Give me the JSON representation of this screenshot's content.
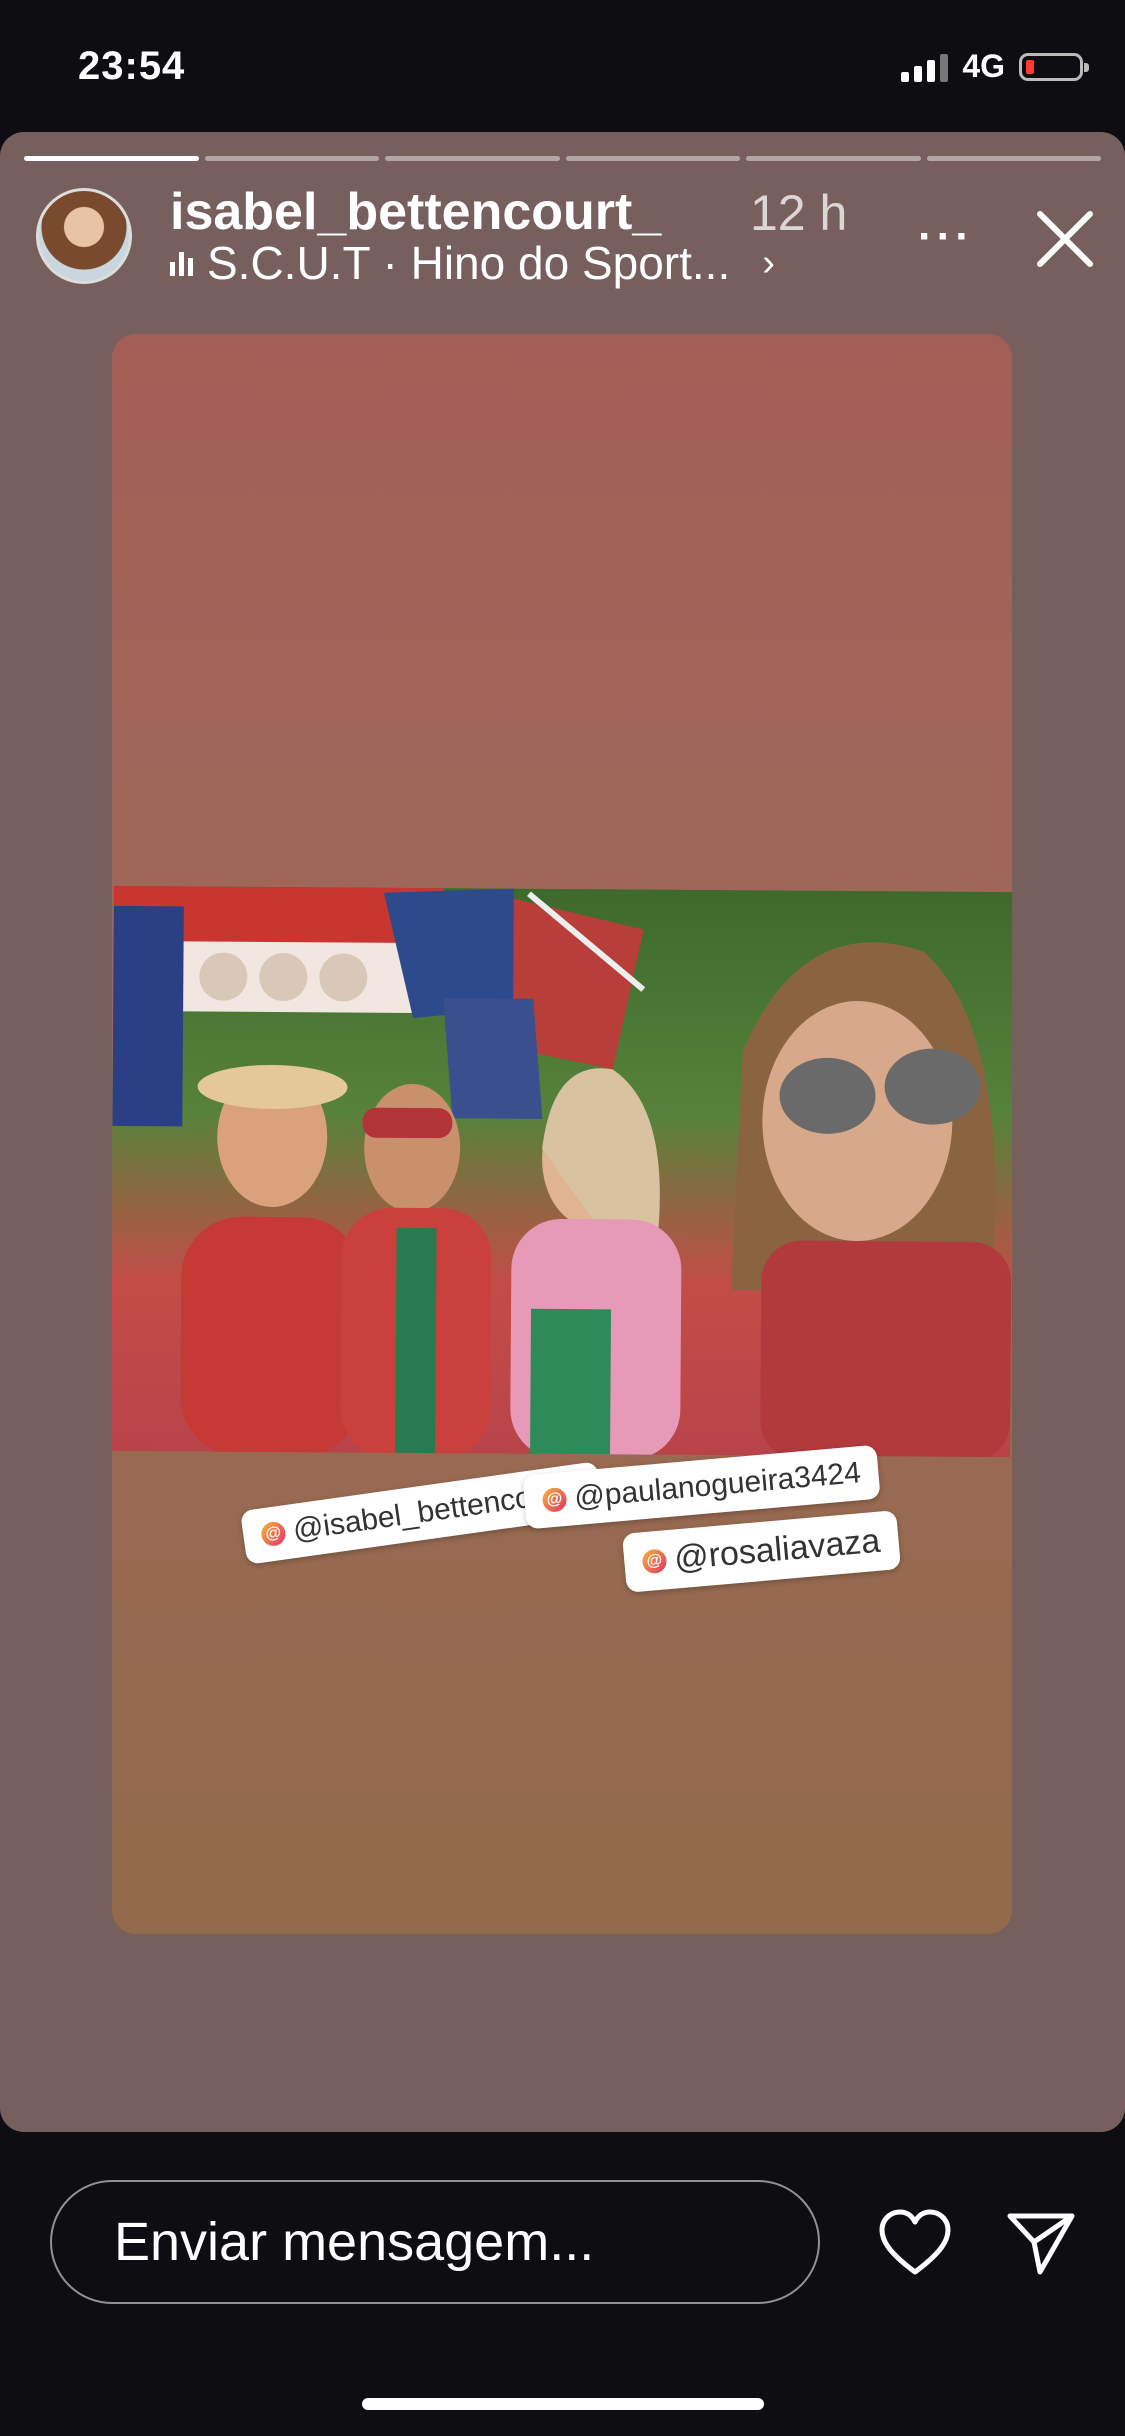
{
  "status_bar": {
    "time": "23:54",
    "network": "4G",
    "battery_level": 0.15,
    "battery_color": "#ff3b30"
  },
  "story": {
    "progress": [
      1,
      0,
      0,
      0,
      0,
      0
    ],
    "username": "isabel_bettencourt_",
    "time_ago": "12 h",
    "music": "S.C.U.T · Hino do Sport...",
    "music_chevron": "›",
    "more_label": "···",
    "close_icon": "close-icon",
    "background_color": "#765f5d"
  },
  "mentions": [
    "@isabel_bettencourt_",
    "@paulanogueira3424",
    "@rosaliavaza"
  ],
  "footer": {
    "message_placeholder": "Enviar mensagem...",
    "like_icon": "heart-icon",
    "send_icon": "send-icon"
  }
}
